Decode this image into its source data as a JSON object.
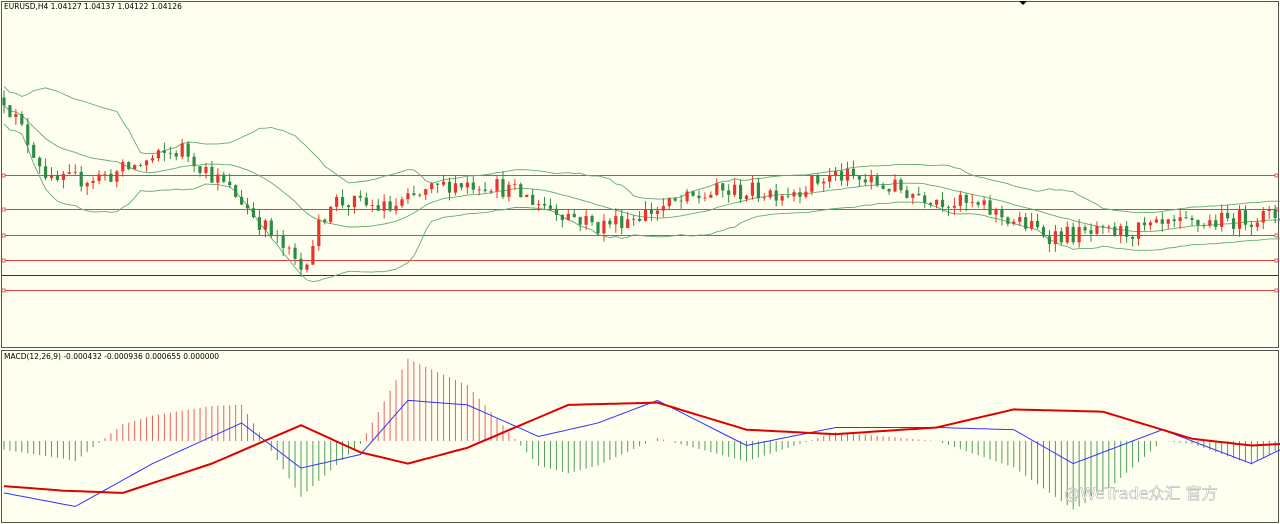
{
  "colors": {
    "background": "#fffff0",
    "frame": "#555555",
    "bull": "#e8342b",
    "bear": "#2e8b45",
    "bands": "#5fae6d",
    "level_line": "#e04040",
    "price_line": "#333333",
    "macd_line": "#3333ff",
    "signal_line": "#dd0000",
    "hist_pos": "#e86060",
    "hist_neg": "#4e9e5a"
  },
  "main_panel": {
    "header": "EURUSD,H4  1.04127 1.04137 1.04122 1.04126"
  },
  "macd_panel": {
    "header": "MACD(12,26,9) -0.000432 -0.000936 0.000655 0.000000"
  },
  "watermark": {
    "text": "@WeTrade众汇 官方"
  },
  "chart_data": [
    {
      "type": "candlestick",
      "symbol": "EURUSD",
      "timeframe": "H4",
      "last_bar": {
        "open": 1.04127,
        "high": 1.04137,
        "low": 1.04122,
        "close": 1.04126
      },
      "indicators": [
        "Bollinger Bands"
      ],
      "horizontal_levels": [
        1.053,
        1.049,
        1.046,
        1.043,
        1.0395
      ],
      "current_price_line": 1.04126,
      "ylim": [
        1.033,
        1.072
      ],
      "bar_count": 170,
      "close_path": [
        [
          0,
          1.062
        ],
        [
          8,
          1.052
        ],
        [
          18,
          1.053
        ],
        [
          30,
          1.056
        ],
        [
          40,
          1.05
        ],
        [
          50,
          1.042
        ],
        [
          55,
          1.05
        ],
        [
          65,
          1.049
        ],
        [
          75,
          1.052
        ],
        [
          82,
          1.052
        ],
        [
          100,
          1.047
        ],
        [
          120,
          1.051
        ],
        [
          132,
          1.051
        ],
        [
          140,
          1.053
        ],
        [
          165,
          1.049
        ],
        [
          176,
          1.046
        ],
        [
          185,
          1.046
        ],
        [
          210,
          1.048
        ],
        [
          230,
          1.049
        ],
        [
          245,
          1.05
        ],
        [
          260,
          1.052
        ],
        [
          280,
          1.045
        ],
        [
          295,
          1.041
        ],
        [
          303,
          1.045
        ],
        [
          315,
          1.046
        ]
      ]
    },
    {
      "type": "macd",
      "params": [
        12,
        26,
        9
      ],
      "values": {
        "macd": -0.000432,
        "signal": -0.000936,
        "histogram": 0.000655,
        "extra": 0.0
      },
      "ylim": [
        -0.0035,
        0.0035
      ],
      "macd_path": [
        [
          0,
          -0.0023
        ],
        [
          12,
          -0.0029
        ],
        [
          25,
          -0.001
        ],
        [
          40,
          0.0008
        ],
        [
          50,
          -0.0012
        ],
        [
          60,
          -0.0006
        ],
        [
          68,
          0.0018
        ],
        [
          78,
          0.0016
        ],
        [
          90,
          0.0002
        ],
        [
          100,
          0.0008
        ],
        [
          110,
          0.0018
        ],
        [
          125,
          -0.0002
        ],
        [
          140,
          0.0006
        ],
        [
          157,
          0.0006
        ],
        [
          170,
          0.0005
        ],
        [
          180,
          -0.001
        ],
        [
          190,
          0.0
        ],
        [
          195,
          0.0005
        ],
        [
          210,
          -0.001
        ],
        [
          225,
          0.0009
        ],
        [
          250,
          0.001
        ],
        [
          275,
          0.0001
        ],
        [
          290,
          -0.0018
        ],
        [
          300,
          -0.0003
        ],
        [
          315,
          0.0005
        ]
      ],
      "signal_path": [
        [
          0,
          -0.002
        ],
        [
          10,
          -0.0022
        ],
        [
          20,
          -0.0023
        ],
        [
          35,
          -0.001
        ],
        [
          50,
          0.0007
        ],
        [
          60,
          -0.0005
        ],
        [
          68,
          -0.001
        ],
        [
          78,
          -0.0003
        ],
        [
          95,
          0.0016
        ],
        [
          110,
          0.0017
        ],
        [
          125,
          0.0005
        ],
        [
          140,
          0.0003
        ],
        [
          157,
          0.0006
        ],
        [
          170,
          0.0014
        ],
        [
          185,
          0.0013
        ],
        [
          200,
          0.0001
        ],
        [
          210,
          -0.0002
        ],
        [
          225,
          0.0
        ],
        [
          245,
          0.0005
        ],
        [
          260,
          0.0006
        ],
        [
          275,
          0.0003
        ],
        [
          285,
          -0.001
        ],
        [
          295,
          -0.0014
        ],
        [
          305,
          -0.0002
        ],
        [
          315,
          0.0
        ]
      ]
    }
  ]
}
